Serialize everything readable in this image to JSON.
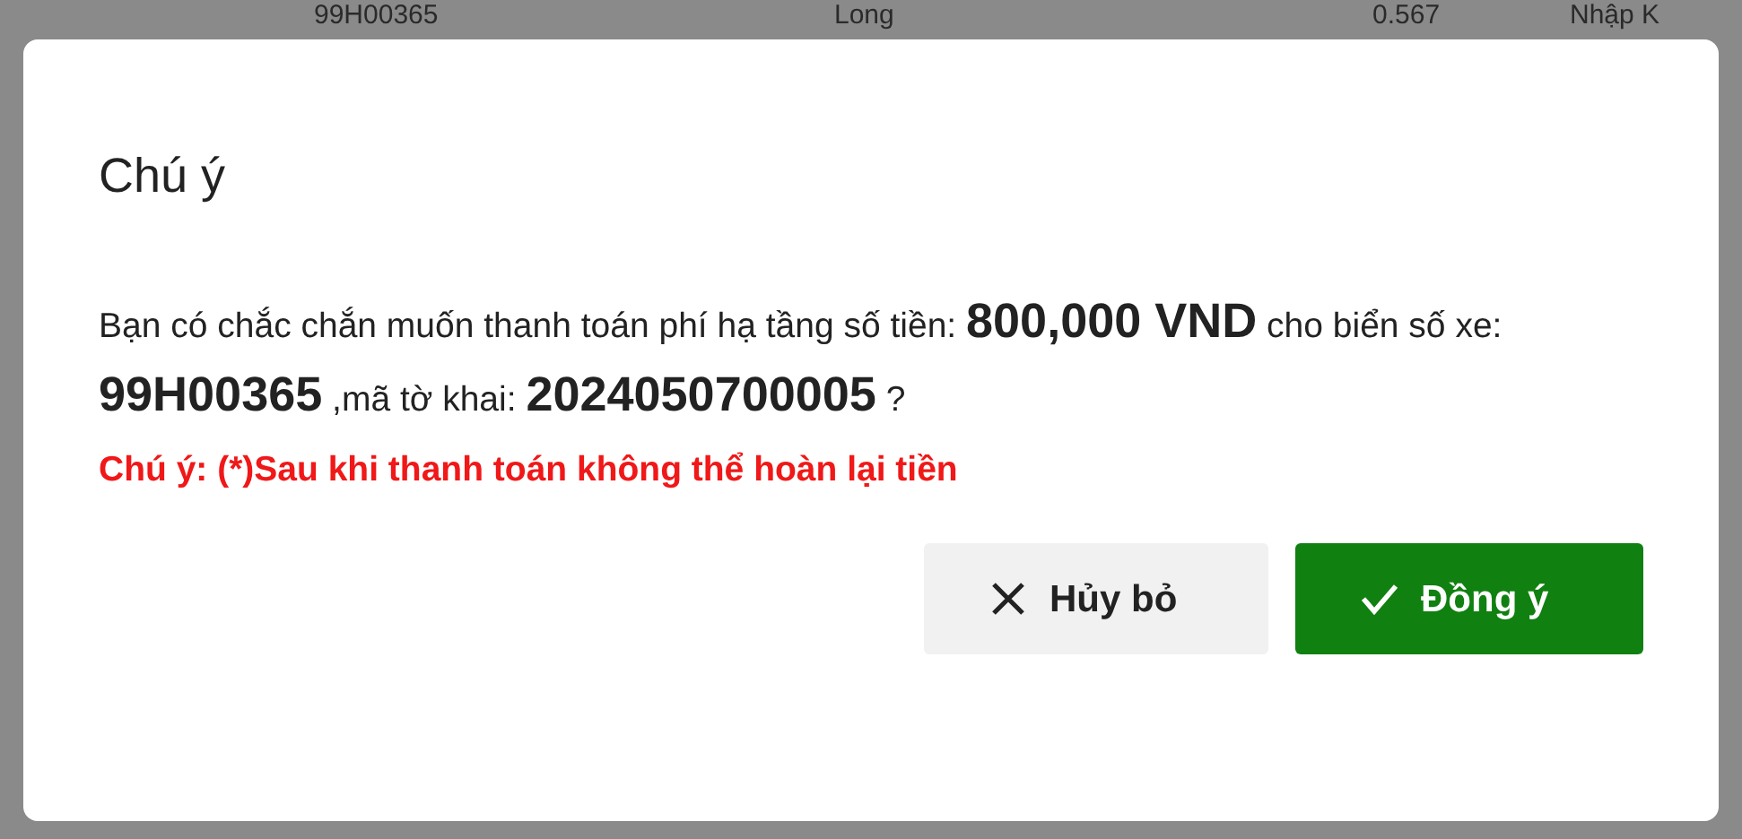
{
  "background_row": {
    "cells": [
      "99H00365",
      "Long",
      "0.567",
      "Nhập K"
    ]
  },
  "dialog": {
    "title": "Chú ý",
    "message": "Bạn có chắc chắn muốn thanh toán phí hạ tầng số tiền: **800,000 VND** cho biển số xe: **99H00365** ,mã tờ khai: **2024050700005** ?",
    "warning": "Chú ý: (*)Sau khi thanh toán không thể hoàn lại tiền",
    "buttons": [
      {
        "label": "Hủy bỏ",
        "kind": "cancel"
      },
      {
        "label": "Đồng ý",
        "kind": "confirm"
      }
    ]
  }
}
